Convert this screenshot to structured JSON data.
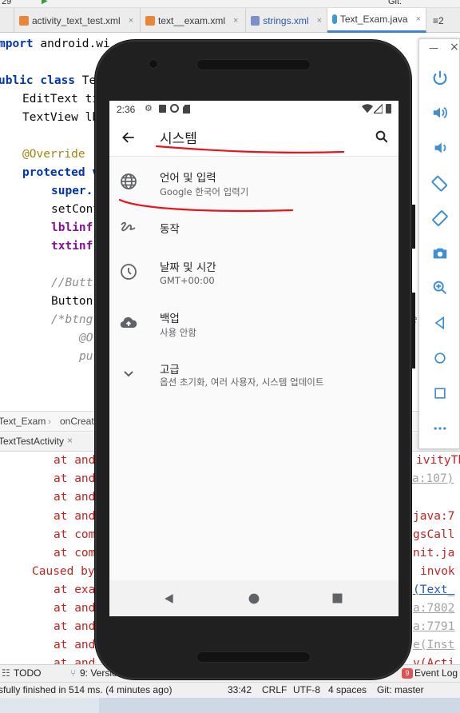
{
  "ide": {
    "tabs": [
      {
        "label": "activity_text_test.xml",
        "active": false
      },
      {
        "label": "text__exam.xml",
        "active": false
      },
      {
        "label": "strings.xml",
        "active": false
      },
      {
        "label": "Text_Exam.java",
        "active": true
      }
    ],
    "tab_overflow": "≡2",
    "toolbar_git": "Git:",
    "toolbar_left": "29",
    "editor": {
      "l1_kw": "mport",
      "l1_rest": " android.wi",
      "l2_kw": "ublic class",
      "l2_rest": " Te",
      "l3": "EditText ti",
      "l4": "TextView lb",
      "l5": "@Override",
      "l6": "protected v",
      "l7_kw": "super.",
      "l8": "setCont",
      "l9_pu": "lblinf",
      "l10_pu": "txtinf",
      "l11": "//Butt",
      "l12": "Button",
      "l13": "/*btng",
      "l14": "@O",
      "l15": "pu",
      "right_frag": "e"
    },
    "breadcrumb": {
      "item1": "Text_Exam",
      "sep": "›",
      "item2": "onCreate"
    },
    "run_tab": "TextTestActivity",
    "console": {
      "rows": [
        {
          "left": "at and",
          "right": "ivityTh"
        },
        {
          "left": "at and",
          "right": "a:107)"
        },
        {
          "left": "at and",
          "right": ""
        },
        {
          "left": "at and",
          "right": "java:7"
        },
        {
          "left": "at com",
          "right": "gsCall"
        },
        {
          "left": "at com",
          "right": "nit.ja"
        },
        {
          "left": "Caused by",
          "right": "invok"
        },
        {
          "left": "at exa",
          "right": "(Text_"
        },
        {
          "left": "at and",
          "right": "a:7802"
        },
        {
          "left": "at and",
          "right": "a:7791"
        },
        {
          "left": "at and",
          "right": "e(Inst"
        },
        {
          "left": "at and",
          "right": "y(Acti"
        }
      ]
    },
    "tool_windows": {
      "todo": "TODO",
      "version": "9: Version",
      "event_log": "Event Log",
      "event_count": "9"
    },
    "status": {
      "message": "sfully finished in 514 ms. (4 minutes ago)",
      "position": "33:42",
      "line_ending": "CRLF",
      "encoding": "UTF-8",
      "indent": "4 spaces",
      "vcs": "Git: master"
    }
  },
  "phone": {
    "status_time": "2:36",
    "app_bar_title": "시스템",
    "items": [
      {
        "title": "언어 및 입력",
        "subtitle": "Google 한국어 입력기",
        "icon": "globe-icon"
      },
      {
        "title": "동작",
        "subtitle": "",
        "icon": "gesture-icon"
      },
      {
        "title": "날짜 및 시간",
        "subtitle": "GMT+00:00",
        "icon": "clock-icon"
      },
      {
        "title": "백업",
        "subtitle": "사용 안함",
        "icon": "cloud-upload-icon"
      },
      {
        "title": "고급",
        "subtitle": "옵션 초기화, 여러 사용자, 시스템 업데이트",
        "icon": "chevron-down-icon"
      }
    ],
    "annotation_color": "#e8141c"
  },
  "emulator_panel": {
    "icons": [
      "power-icon",
      "volume-up-icon",
      "volume-down-icon",
      "rotate-left-icon",
      "rotate-right-icon",
      "camera-icon",
      "zoom-icon",
      "back-icon",
      "home-icon",
      "overview-icon",
      "more-icon"
    ],
    "accent": "#3f8fd2",
    "window_min": "—",
    "window_close": "×"
  }
}
